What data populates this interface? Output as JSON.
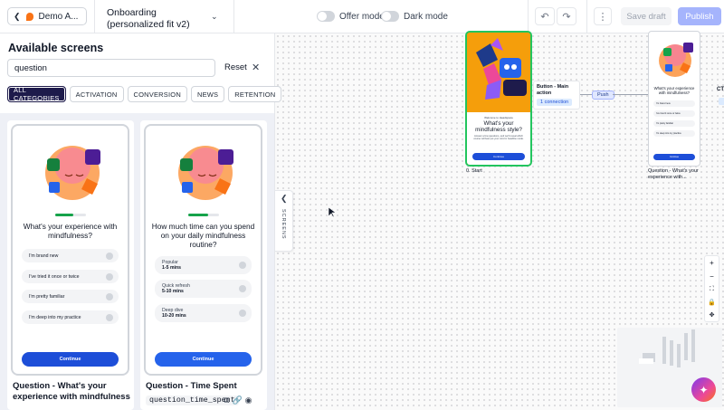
{
  "topbar": {
    "app_name": "Demo A...",
    "flow_title": "Onboarding (personalized fit v2)",
    "offer_mode": "Offer mode",
    "dark_mode": "Dark mode",
    "save_draft": "Save draft",
    "publish": "Publish"
  },
  "sidebar": {
    "title": "Available screens",
    "search_value": "question",
    "reset": "Reset",
    "chips": [
      "ALL CATEGORIES",
      "ACTIVATION",
      "CONVERSION",
      "NEWS",
      "RETENTION"
    ],
    "collapse_label": "SCREENS"
  },
  "cards": [
    {
      "question": "What's your experience with mindfulness?",
      "options": [
        "I'm brand new",
        "I've tried it once or twice",
        "I'm pretty familiar",
        "I'm deep into my practice"
      ],
      "cta": "Continue",
      "title": "Question - What's your experience with mindfulness",
      "progress": 0.6
    },
    {
      "question": "How much time can you spend on your daily mindfulness routine?",
      "options": [
        {
          "label": "Popular",
          "sub": "1-5 mins"
        },
        {
          "label": "Quick refresh",
          "sub": "5-10 mins"
        },
        {
          "label": "Deep dive",
          "sub": "10-20 mins"
        }
      ],
      "cta": "Continue",
      "title": "Question - Time Spent",
      "code": "question_time_spent",
      "progress": 0.65
    }
  ],
  "canvas": {
    "start_node": {
      "welcome": "Welcome to Headspace",
      "title": "What's your mindfulness style?",
      "desc": "Answer a few questions, and we'll reveal which course will best put your mind in headline mode.",
      "cta": "Continue",
      "label": "0. Start"
    },
    "action": {
      "title": "Button - Main action",
      "badge": "1 connection"
    },
    "push": "Push",
    "question_node": {
      "title": "What's your experience with mindfulness?",
      "options": [
        "I'm brand new",
        "I've tried it once or twice",
        "I'm pretty familiar",
        "I'm deep into my practice"
      ],
      "cta": "Continue",
      "label": "Question - What's your experience with..."
    },
    "cta_stub": "CT"
  },
  "colors": {
    "accent": "#1e1b4b",
    "primary_blue": "#1d4ed8",
    "start_border": "#22c55e",
    "publish_bg": "#a5b4fc"
  }
}
